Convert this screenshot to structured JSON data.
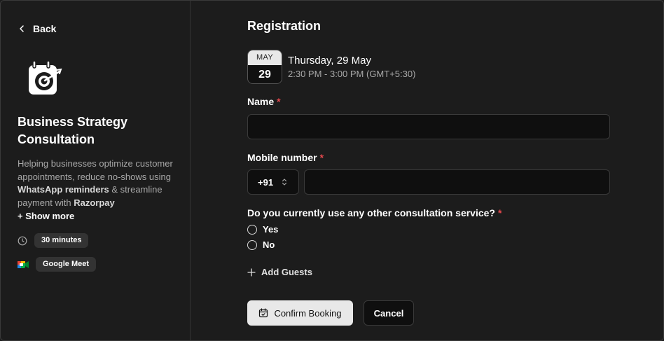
{
  "sidebar": {
    "back_label": "Back",
    "event_title": "Business Strategy Consultation",
    "description": {
      "part1": "Helping businesses optimize customer appointments, reduce no-shows using ",
      "bold1": "WhatsApp reminders",
      "part2": " & streamline payment with ",
      "bold2": "Razorpay"
    },
    "show_more": "+ Show more",
    "duration": "30 minutes",
    "location": "Google Meet"
  },
  "form": {
    "title": "Registration",
    "date": {
      "month": "MAY",
      "day": "29",
      "full": "Thursday, 29 May",
      "time": "2:30 PM - 3:00 PM (GMT+5:30)"
    },
    "name_label": "Name",
    "mobile_label": "Mobile number",
    "country_code": "+91",
    "question": "Do you currently use any other consultation service?",
    "options": [
      "Yes",
      "No"
    ],
    "required_mark": "*",
    "add_guests": "Add Guests",
    "confirm_label": "Confirm Booking",
    "cancel_label": "Cancel"
  },
  "colors": {
    "background": "#1c1c1c",
    "input_bg": "#0f0f0f",
    "required": "#e5484d",
    "primary_button": "#e8e8e8"
  }
}
